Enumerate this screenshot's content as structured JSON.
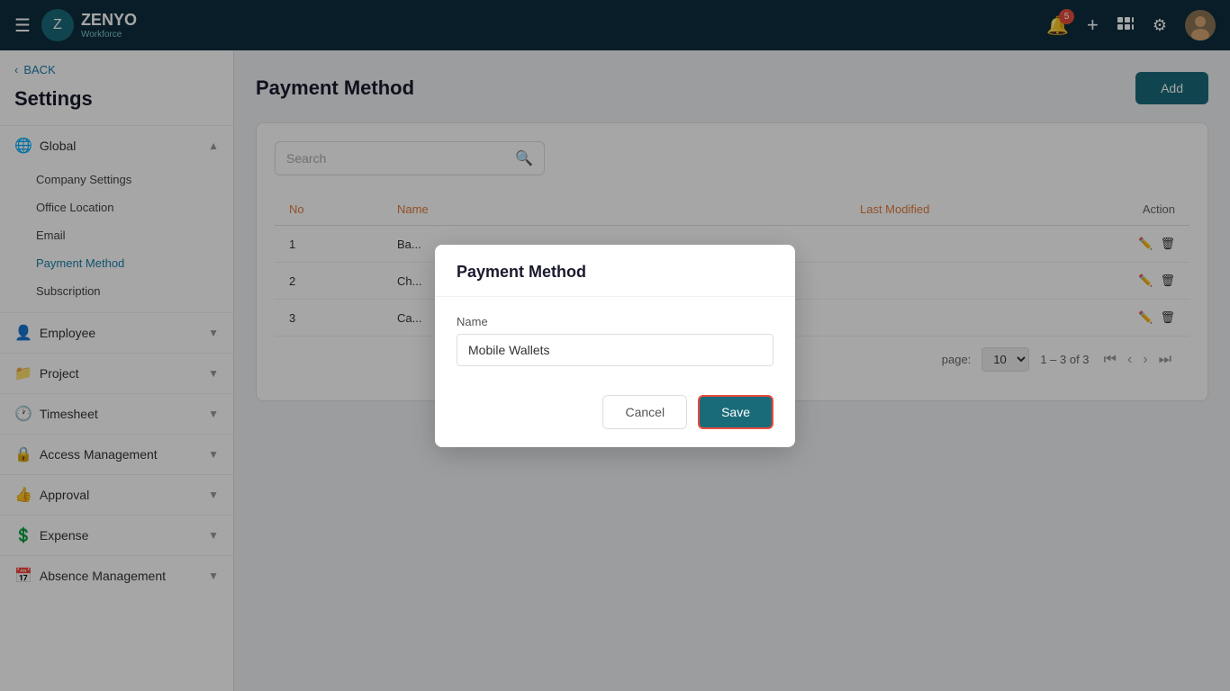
{
  "navbar": {
    "logo_text": "ZENYO",
    "logo_sub": "Workforce",
    "hamburger_icon": "☰",
    "notification_badge": "5",
    "add_icon": "+",
    "grid_icon": "⊞",
    "settings_icon": "⚙",
    "avatar_initial": "👤"
  },
  "sidebar": {
    "back_label": "BACK",
    "title": "Settings",
    "groups": [
      {
        "id": "global",
        "icon": "🌐",
        "label": "Global",
        "expanded": true,
        "items": [
          {
            "label": "Company Settings",
            "active": false
          },
          {
            "label": "Office Location",
            "active": false
          },
          {
            "label": "Email",
            "active": false
          },
          {
            "label": "Payment Method",
            "active": true
          },
          {
            "label": "Subscription",
            "active": false
          }
        ]
      },
      {
        "id": "employee",
        "icon": "👤",
        "label": "Employee",
        "expanded": false,
        "items": []
      },
      {
        "id": "project",
        "icon": "📁",
        "label": "Project",
        "expanded": false,
        "items": []
      },
      {
        "id": "timesheet",
        "icon": "🕐",
        "label": "Timesheet",
        "expanded": false,
        "items": []
      },
      {
        "id": "access-management",
        "icon": "🔒",
        "label": "Access Management",
        "expanded": false,
        "items": []
      },
      {
        "id": "approval",
        "icon": "👍",
        "label": "Approval",
        "expanded": false,
        "items": []
      },
      {
        "id": "expense",
        "icon": "💲",
        "label": "Expense",
        "expanded": false,
        "items": []
      },
      {
        "id": "absence-management",
        "icon": "📅",
        "label": "Absence Management",
        "expanded": false,
        "items": []
      }
    ]
  },
  "main": {
    "page_title": "Payment Method",
    "add_button": "Add",
    "search_placeholder": "Search",
    "table": {
      "columns": [
        "No",
        "Name",
        "Last Modified",
        "Action"
      ],
      "rows": [
        {
          "no": "1",
          "name": "Ba...",
          "last_modified": ""
        },
        {
          "no": "2",
          "name": "Ch...",
          "last_modified": ""
        },
        {
          "no": "3",
          "name": "Ca...",
          "last_modified": ""
        }
      ]
    },
    "pagination": {
      "per_page_label": "page:",
      "per_page_value": "10",
      "info": "1 – 3 of 3"
    }
  },
  "modal": {
    "title": "Payment Method",
    "name_label": "Name",
    "name_value": "Mobile Wallets",
    "cancel_label": "Cancel",
    "save_label": "Save"
  }
}
